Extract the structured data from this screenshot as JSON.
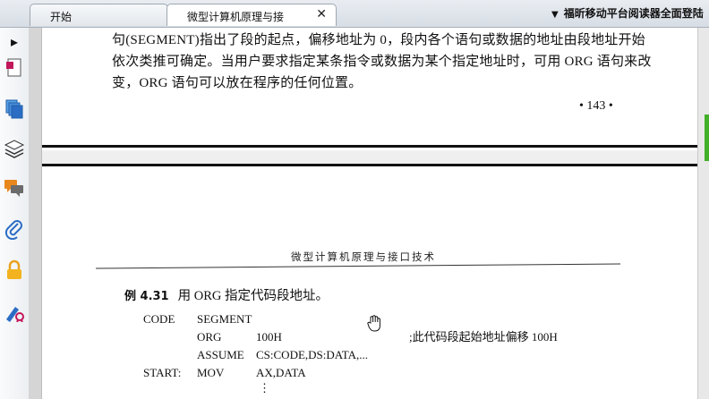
{
  "tabs": [
    {
      "label": "开始",
      "active": false
    },
    {
      "label": "微型计算机原理与接",
      "active": true,
      "close": "✕"
    }
  ],
  "tabbar_right": {
    "caret": "▼",
    "label": "福昕移动平台阅读器全面登陆"
  },
  "toolbar": {
    "expand": "▸"
  },
  "page_top": {
    "lines": [
      "句(SEGMENT)指出了段的起点，偏移地址为 0，段内各个语句或数据的地址由段地址开始",
      "依次类推可确定。当用户要求指定某条指令或数据为某个指定地址时，可用 ORG 语句来改",
      "变，ORG 语句可以放在程序的任何位置。"
    ],
    "page_number": "• 143 •"
  },
  "page_bottom": {
    "running_head": "微型计算机原理与接口技术",
    "example_label": "例 4.31",
    "example_title": "用 ORG 指定代码段地址。",
    "code": {
      "r1": {
        "label": "CODE",
        "op": "SEGMENT",
        "args": ""
      },
      "r2": {
        "label": "",
        "op": "ORG",
        "args": "100H",
        "comment": ";此代码段起始地址偏移 100H"
      },
      "r3": {
        "label": "",
        "op": "ASSUME",
        "args": "CS:CODE,DS:DATA,..."
      },
      "r4": {
        "label": "START:",
        "op": "MOV",
        "args": "AX,DATA"
      },
      "r5": {
        "args": "⋮"
      }
    }
  },
  "colors": {
    "scroll_handle": "#43b02a",
    "accent_orange": "#e8871e",
    "accent_blue": "#2b6cc4"
  }
}
